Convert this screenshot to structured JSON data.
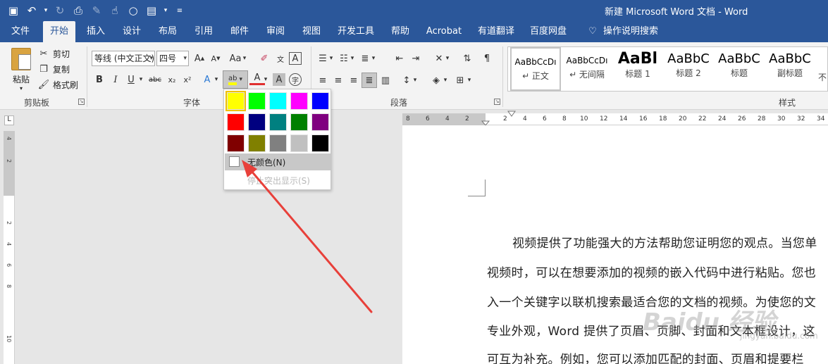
{
  "window": {
    "title": "新建 Microsoft Word 文档  -  Word"
  },
  "tabs": [
    "文件",
    "开始",
    "插入",
    "设计",
    "布局",
    "引用",
    "邮件",
    "审阅",
    "视图",
    "开发工具",
    "帮助",
    "Acrobat",
    "有道翻译",
    "百度网盘",
    "操作说明搜索"
  ],
  "clipboard": {
    "paste": "粘贴",
    "cut": "剪切",
    "copy": "复制",
    "format_painter": "格式刷",
    "group": "剪贴板"
  },
  "font": {
    "name": "等线 (中文正文)",
    "size": "四号",
    "group": "字体"
  },
  "paragraph": {
    "group": "段落"
  },
  "styles": {
    "group": "样式",
    "items": [
      {
        "sample": "AaBbCcDı",
        "name": "↵ 正文"
      },
      {
        "sample": "AaBbCcDı",
        "name": "↵ 无间隔"
      },
      {
        "sample": "AaBl",
        "name": "标题 1"
      },
      {
        "sample": "AaBbC",
        "name": "标题 2"
      },
      {
        "sample": "AaBbC",
        "name": "标题"
      },
      {
        "sample": "AaBbC",
        "name": "副标题"
      },
      {
        "sample": "",
        "name": "不"
      }
    ]
  },
  "highlight_palette": {
    "colors": [
      "#ffff00",
      "#00ff00",
      "#00ffff",
      "#ff00ff",
      "#0000ff",
      "#ff0000",
      "#000080",
      "#008080",
      "#008000",
      "#800080",
      "#800000",
      "#808000",
      "#808080",
      "#c0c0c0",
      "#000000"
    ],
    "selected": "#ffff00",
    "no_color": "无颜色(N)",
    "stop": "停止突出显示(S)"
  },
  "ruler": {
    "top_numbers": [
      "8",
      "6",
      "4",
      "2",
      "2",
      "4",
      "6",
      "8",
      "10",
      "12",
      "14",
      "16",
      "18",
      "20",
      "22",
      "24",
      "26",
      "28",
      "30",
      "32",
      "34"
    ],
    "left_numbers": [
      "4",
      "2",
      "2",
      "4",
      "6",
      "8",
      "10"
    ],
    "corner": "L"
  },
  "document": {
    "lines": [
      "视频提供了功能强大的方法帮助您证明您的观点。当您单",
      "视频时，可以在想要添加的视频的嵌入代码中进行粘贴。您也",
      "入一个关键字以联机搜索最适合您的文档的视频。为使您的文",
      "专业外观，Word 提供了页眉、页脚、封面和文本框设计，这",
      "可互为补充。例如，您可以添加匹配的封面、页眉和提要栏"
    ]
  },
  "watermark": {
    "main": "Baidu 经验",
    "sub": "jingyan.baidu.com"
  },
  "colors": {
    "brand": "#2b579a",
    "ribbon": "#f3f3f3",
    "annotation_arrow": "#e8403a"
  }
}
